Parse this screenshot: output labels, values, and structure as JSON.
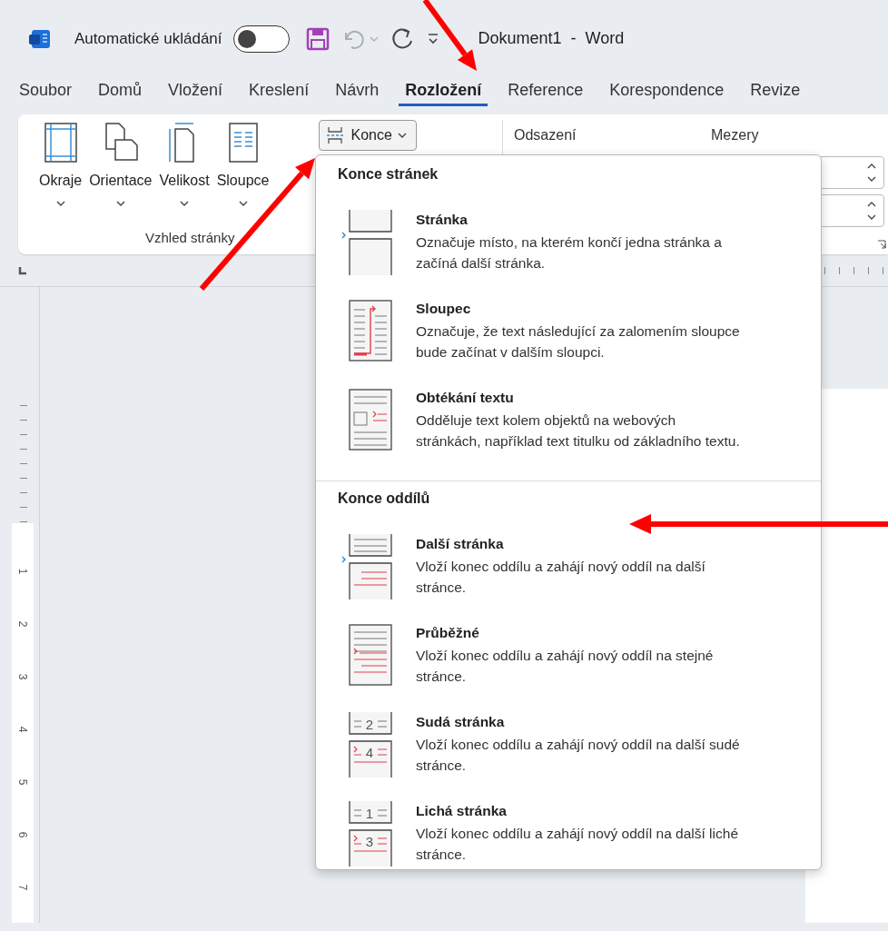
{
  "title_bar": {
    "autosave_label": "Automatické ukládání",
    "autosave_on": false,
    "title": "Dokument1  -  Word"
  },
  "tabs": [
    {
      "label": "Soubor",
      "selected": false
    },
    {
      "label": "Domů",
      "selected": false
    },
    {
      "label": "Vložení",
      "selected": false
    },
    {
      "label": "Kreslení",
      "selected": false
    },
    {
      "label": "Návrh",
      "selected": false
    },
    {
      "label": "Rozložení",
      "selected": true
    },
    {
      "label": "Reference",
      "selected": false
    },
    {
      "label": "Korespondence",
      "selected": false
    },
    {
      "label": "Revize",
      "selected": false
    }
  ],
  "ribbon": {
    "page_setup": {
      "buttons": [
        {
          "kind": "margins",
          "label": "Okraje"
        },
        {
          "kind": "orientation",
          "label": "Orientace"
        },
        {
          "kind": "size",
          "label": "Velikost"
        },
        {
          "kind": "columns",
          "label": "Sloupce"
        }
      ],
      "breaks_button": "Konce",
      "group_label": "Vzhled stránky"
    },
    "paragraph": {
      "indent_label": "Odsazení",
      "spacing_label": "Mezery"
    }
  },
  "breaks_menu": {
    "sections": [
      {
        "heading": "Konce stránek",
        "items": [
          {
            "kind": "page",
            "title": "Stránka",
            "description": "Označuje místo, na kterém končí jedna stránka a začíná další stránka."
          },
          {
            "kind": "column",
            "title": "Sloupec",
            "description": "Označuje, že text následující za zalomením sloupce bude začínat v dalším sloupci."
          },
          {
            "kind": "text_wrap",
            "title": "Obtékání textu",
            "description": "Odděluje text kolem objektů na webových stránkách, například text titulku od základního textu."
          }
        ]
      },
      {
        "heading": "Konce oddílů",
        "items": [
          {
            "kind": "next_page",
            "title": "Další stránka",
            "description": "Vloží konec oddílu a zahájí nový oddíl na další stránce."
          },
          {
            "kind": "continuous",
            "title": "Průběžné",
            "description": "Vloží konec oddílu a zahájí nový oddíl na stejné stránce."
          },
          {
            "kind": "even_page",
            "title": "Sudá stránka",
            "description": "Vloží konec oddílu a zahájí nový oddíl na další sudé stránce.",
            "icon_numbers": [
              "2",
              "4"
            ]
          },
          {
            "kind": "odd_page",
            "title": "Lichá stránka",
            "description": "Vloží konec oddílu a zahájí nový oddíl na další liché stránce.",
            "icon_numbers": [
              "1",
              "3"
            ]
          }
        ]
      }
    ]
  },
  "vertical_ruler": [
    "1",
    "2",
    "3",
    "4",
    "5",
    "6",
    "7"
  ]
}
